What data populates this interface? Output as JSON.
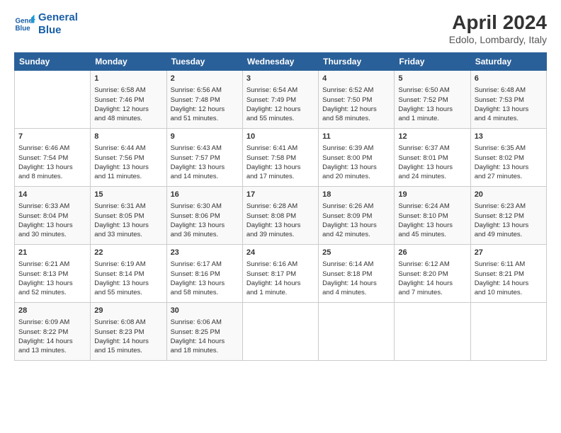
{
  "header": {
    "logo_line1": "General",
    "logo_line2": "Blue",
    "title": "April 2024",
    "subtitle": "Edolo, Lombardy, Italy"
  },
  "columns": [
    "Sunday",
    "Monday",
    "Tuesday",
    "Wednesday",
    "Thursday",
    "Friday",
    "Saturday"
  ],
  "weeks": [
    [
      {
        "day": "",
        "lines": []
      },
      {
        "day": "1",
        "lines": [
          "Sunrise: 6:58 AM",
          "Sunset: 7:46 PM",
          "Daylight: 12 hours",
          "and 48 minutes."
        ]
      },
      {
        "day": "2",
        "lines": [
          "Sunrise: 6:56 AM",
          "Sunset: 7:48 PM",
          "Daylight: 12 hours",
          "and 51 minutes."
        ]
      },
      {
        "day": "3",
        "lines": [
          "Sunrise: 6:54 AM",
          "Sunset: 7:49 PM",
          "Daylight: 12 hours",
          "and 55 minutes."
        ]
      },
      {
        "day": "4",
        "lines": [
          "Sunrise: 6:52 AM",
          "Sunset: 7:50 PM",
          "Daylight: 12 hours",
          "and 58 minutes."
        ]
      },
      {
        "day": "5",
        "lines": [
          "Sunrise: 6:50 AM",
          "Sunset: 7:52 PM",
          "Daylight: 13 hours",
          "and 1 minute."
        ]
      },
      {
        "day": "6",
        "lines": [
          "Sunrise: 6:48 AM",
          "Sunset: 7:53 PM",
          "Daylight: 13 hours",
          "and 4 minutes."
        ]
      }
    ],
    [
      {
        "day": "7",
        "lines": [
          "Sunrise: 6:46 AM",
          "Sunset: 7:54 PM",
          "Daylight: 13 hours",
          "and 8 minutes."
        ]
      },
      {
        "day": "8",
        "lines": [
          "Sunrise: 6:44 AM",
          "Sunset: 7:56 PM",
          "Daylight: 13 hours",
          "and 11 minutes."
        ]
      },
      {
        "day": "9",
        "lines": [
          "Sunrise: 6:43 AM",
          "Sunset: 7:57 PM",
          "Daylight: 13 hours",
          "and 14 minutes."
        ]
      },
      {
        "day": "10",
        "lines": [
          "Sunrise: 6:41 AM",
          "Sunset: 7:58 PM",
          "Daylight: 13 hours",
          "and 17 minutes."
        ]
      },
      {
        "day": "11",
        "lines": [
          "Sunrise: 6:39 AM",
          "Sunset: 8:00 PM",
          "Daylight: 13 hours",
          "and 20 minutes."
        ]
      },
      {
        "day": "12",
        "lines": [
          "Sunrise: 6:37 AM",
          "Sunset: 8:01 PM",
          "Daylight: 13 hours",
          "and 24 minutes."
        ]
      },
      {
        "day": "13",
        "lines": [
          "Sunrise: 6:35 AM",
          "Sunset: 8:02 PM",
          "Daylight: 13 hours",
          "and 27 minutes."
        ]
      }
    ],
    [
      {
        "day": "14",
        "lines": [
          "Sunrise: 6:33 AM",
          "Sunset: 8:04 PM",
          "Daylight: 13 hours",
          "and 30 minutes."
        ]
      },
      {
        "day": "15",
        "lines": [
          "Sunrise: 6:31 AM",
          "Sunset: 8:05 PM",
          "Daylight: 13 hours",
          "and 33 minutes."
        ]
      },
      {
        "day": "16",
        "lines": [
          "Sunrise: 6:30 AM",
          "Sunset: 8:06 PM",
          "Daylight: 13 hours",
          "and 36 minutes."
        ]
      },
      {
        "day": "17",
        "lines": [
          "Sunrise: 6:28 AM",
          "Sunset: 8:08 PM",
          "Daylight: 13 hours",
          "and 39 minutes."
        ]
      },
      {
        "day": "18",
        "lines": [
          "Sunrise: 6:26 AM",
          "Sunset: 8:09 PM",
          "Daylight: 13 hours",
          "and 42 minutes."
        ]
      },
      {
        "day": "19",
        "lines": [
          "Sunrise: 6:24 AM",
          "Sunset: 8:10 PM",
          "Daylight: 13 hours",
          "and 45 minutes."
        ]
      },
      {
        "day": "20",
        "lines": [
          "Sunrise: 6:23 AM",
          "Sunset: 8:12 PM",
          "Daylight: 13 hours",
          "and 49 minutes."
        ]
      }
    ],
    [
      {
        "day": "21",
        "lines": [
          "Sunrise: 6:21 AM",
          "Sunset: 8:13 PM",
          "Daylight: 13 hours",
          "and 52 minutes."
        ]
      },
      {
        "day": "22",
        "lines": [
          "Sunrise: 6:19 AM",
          "Sunset: 8:14 PM",
          "Daylight: 13 hours",
          "and 55 minutes."
        ]
      },
      {
        "day": "23",
        "lines": [
          "Sunrise: 6:17 AM",
          "Sunset: 8:16 PM",
          "Daylight: 13 hours",
          "and 58 minutes."
        ]
      },
      {
        "day": "24",
        "lines": [
          "Sunrise: 6:16 AM",
          "Sunset: 8:17 PM",
          "Daylight: 14 hours",
          "and 1 minute."
        ]
      },
      {
        "day": "25",
        "lines": [
          "Sunrise: 6:14 AM",
          "Sunset: 8:18 PM",
          "Daylight: 14 hours",
          "and 4 minutes."
        ]
      },
      {
        "day": "26",
        "lines": [
          "Sunrise: 6:12 AM",
          "Sunset: 8:20 PM",
          "Daylight: 14 hours",
          "and 7 minutes."
        ]
      },
      {
        "day": "27",
        "lines": [
          "Sunrise: 6:11 AM",
          "Sunset: 8:21 PM",
          "Daylight: 14 hours",
          "and 10 minutes."
        ]
      }
    ],
    [
      {
        "day": "28",
        "lines": [
          "Sunrise: 6:09 AM",
          "Sunset: 8:22 PM",
          "Daylight: 14 hours",
          "and 13 minutes."
        ]
      },
      {
        "day": "29",
        "lines": [
          "Sunrise: 6:08 AM",
          "Sunset: 8:23 PM",
          "Daylight: 14 hours",
          "and 15 minutes."
        ]
      },
      {
        "day": "30",
        "lines": [
          "Sunrise: 6:06 AM",
          "Sunset: 8:25 PM",
          "Daylight: 14 hours",
          "and 18 minutes."
        ]
      },
      {
        "day": "",
        "lines": []
      },
      {
        "day": "",
        "lines": []
      },
      {
        "day": "",
        "lines": []
      },
      {
        "day": "",
        "lines": []
      }
    ]
  ]
}
